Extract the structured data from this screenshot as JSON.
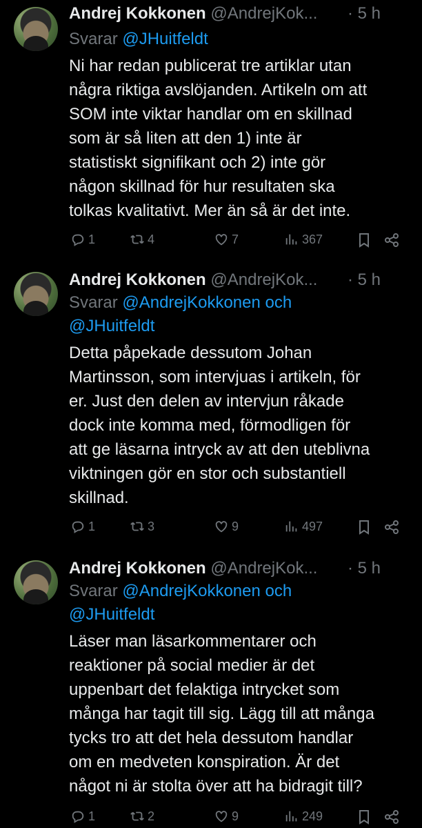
{
  "tweets": [
    {
      "name": "Andrej Kokkonen",
      "handle": "@AndrejKok...",
      "time": "· 5 h",
      "more": "···",
      "reply_prefix": "Svarar",
      "reply_mentions_line1": "@JHuitfeldt",
      "reply_mentions_line2": "",
      "body_lines": [
        "Ni har redan publicerat tre artiklar utan",
        "några riktiga avslöjanden. Artikeln om att",
        "SOM inte viktar handlar om en skillnad",
        "som är så liten att den 1) inte är",
        "statistiskt signifikant och 2) inte gör",
        "någon skillnad för hur resultaten ska",
        "tolkas kvalitativt. Mer än så är det inte."
      ],
      "replies": "1",
      "retweets": "4",
      "likes": "7",
      "views": "367"
    },
    {
      "name": "Andrej Kokkonen",
      "handle": "@AndrejKok...",
      "time": "· 5 h",
      "more": "···",
      "reply_prefix": "Svarar",
      "reply_mentions_line1": "@AndrejKokkonen och",
      "reply_mentions_line2": "@JHuitfeldt",
      "body_lines": [
        "Detta påpekade dessutom Johan",
        "Martinsson, som intervjuas i artikeln, för",
        "er. Just den delen av intervjun råkade",
        "dock inte komma med, förmodligen för",
        "att ge läsarna intryck av att den uteblivna",
        "viktningen gör en stor och substantiell",
        "skillnad."
      ],
      "replies": "1",
      "retweets": "3",
      "likes": "9",
      "views": "497"
    },
    {
      "name": "Andrej Kokkonen",
      "handle": "@AndrejKok...",
      "time": "· 5 h",
      "more": "···",
      "reply_prefix": "Svarar",
      "reply_mentions_line1": "@AndrejKokkonen och",
      "reply_mentions_line2": "@JHuitfeldt",
      "body_lines": [
        "Läser man läsarkommentarer och",
        "reaktioner på social medier är det",
        "uppenbart det felaktiga intrycket som",
        "många har tagit till sig. Lägg till att många",
        "tycks tro att det hela dessutom handlar",
        "om en medveten konspiration. Är det",
        "något ni är stolta över att ha bidragit till?"
      ],
      "replies": "1",
      "retweets": "2",
      "likes": "9",
      "views": "249"
    }
  ]
}
